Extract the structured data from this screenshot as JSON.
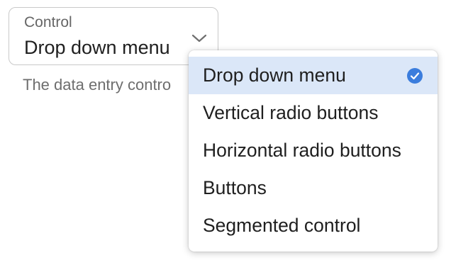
{
  "field": {
    "label": "Control",
    "value": "Drop down menu",
    "helper_text": "The data entry contro"
  },
  "menu": {
    "items": [
      {
        "label": "Drop down menu",
        "selected": true
      },
      {
        "label": "Vertical radio buttons",
        "selected": false
      },
      {
        "label": "Horizontal radio buttons",
        "selected": false
      },
      {
        "label": "Buttons",
        "selected": false
      },
      {
        "label": "Segmented control",
        "selected": false
      }
    ]
  },
  "colors": {
    "accent": "#3b7ddd",
    "selected_bg": "#dbe7f8",
    "border": "#c9c9c9"
  },
  "icons": {
    "dropdown": "chevron-down-icon",
    "selected": "check-circle-icon"
  }
}
